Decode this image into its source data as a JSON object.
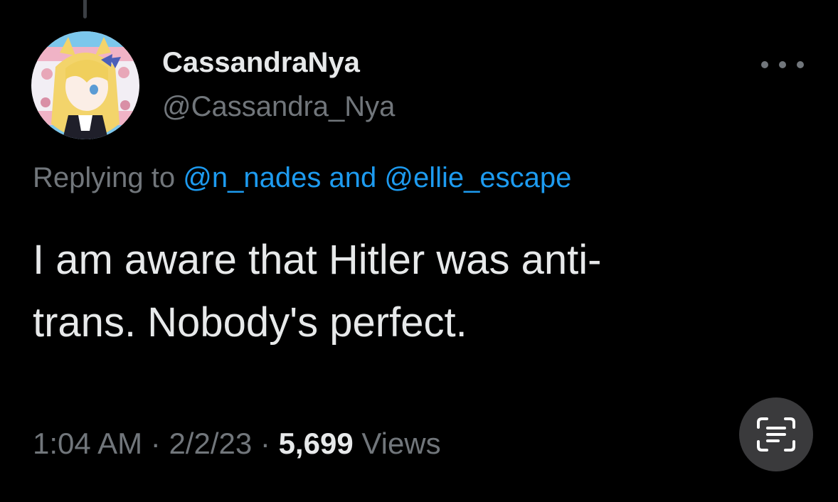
{
  "user": {
    "display_name": "CassandraNya",
    "handle": "@Cassandra_Nya"
  },
  "reply": {
    "prefix": "Replying to",
    "mention_1": "@n_nades",
    "conjunction": "and",
    "mention_2": "@ellie_escape"
  },
  "tweet": {
    "line_1": "I am aware that Hitler was anti-",
    "line_2": "trans. Nobody's perfect."
  },
  "meta": {
    "time": "1:04 AM",
    "separator": "·",
    "date": "2/2/23",
    "views_count": "5,699",
    "views_label": "Views"
  },
  "icons": {
    "more": "more-dots-icon",
    "scan": "live-text-scan-icon"
  },
  "colors": {
    "background": "#000000",
    "primary_text": "#e7e9ea",
    "secondary_text": "#71767b",
    "link": "#1d9bf0"
  }
}
